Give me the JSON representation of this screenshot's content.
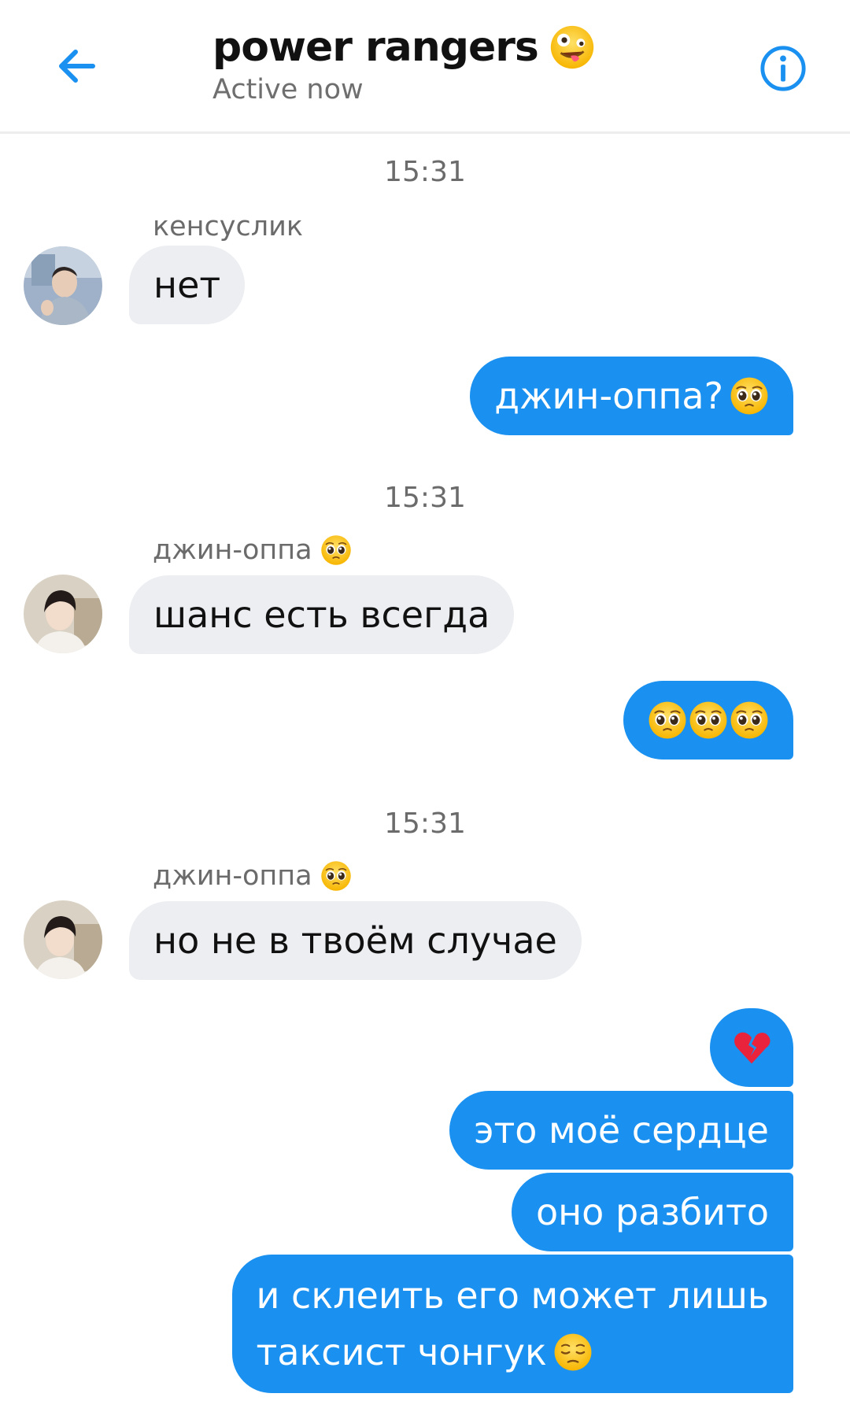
{
  "header": {
    "title": "power rangers",
    "title_emoji_icon": "zany-face-icon",
    "subtitle": "Active now",
    "back_icon": "arrow-left-icon",
    "info_icon": "info-icon",
    "accent": "#1a91f0"
  },
  "chat": {
    "timestamps": [
      "15:31",
      "15:31",
      "15:31"
    ],
    "incoming": [
      {
        "sender": "кенсуслик",
        "sender_emoji_icon": "",
        "text": "нет"
      },
      {
        "sender": "джин-оппа",
        "sender_emoji_icon": "pleading-face-icon",
        "text": "шанс есть всегда"
      },
      {
        "sender": "джин-оппа",
        "sender_emoji_icon": "pleading-face-icon",
        "text": "но не в твоём случае"
      }
    ],
    "outgoing": [
      {
        "text": "джин-оппа?",
        "emoji_icon": "pleading-face-icon"
      },
      {
        "text": "",
        "emoji_icons": [
          "pleading-face-icon",
          "pleading-face-icon",
          "pleading-face-icon"
        ]
      },
      {
        "text": "",
        "emoji_icon": "broken-heart-icon"
      },
      {
        "text": "это моё сердце"
      },
      {
        "text": "оно разбито"
      },
      {
        "line1": "и склеить его может лишь",
        "line2": "таксист чонгук",
        "emoji_icon": "pensive-face-icon"
      }
    ],
    "colors": {
      "incoming_bubble": "#eceef2",
      "outgoing_bubble": "#1a91f0",
      "meta_text": "#6b6b6b"
    }
  }
}
